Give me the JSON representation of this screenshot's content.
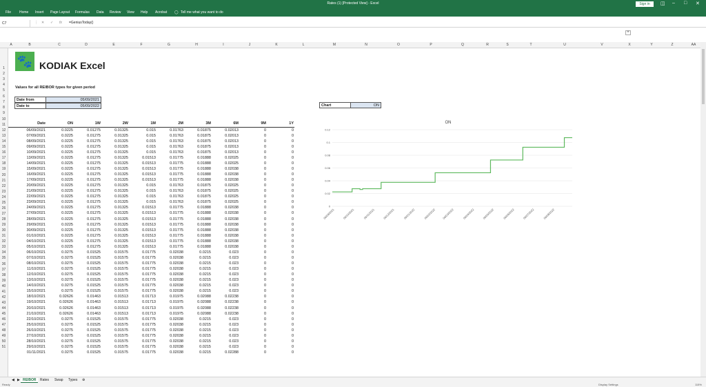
{
  "window": {
    "title": "Rates (1) [Protected View] - Excel",
    "signin": "Sign in"
  },
  "menu": [
    "File",
    "Home",
    "Insert",
    "Page Layout",
    "Formulas",
    "Data",
    "Review",
    "View",
    "Help",
    "Acrobat",
    "Tell me what you want to do"
  ],
  "formula_bar": {
    "name_box": "C7",
    "formula": "=GeniusToday()"
  },
  "columns": [
    "A",
    "B",
    "C",
    "D",
    "E",
    "F",
    "G",
    "H",
    "I",
    "J",
    "K",
    "L",
    "M",
    "N",
    "O",
    "P",
    "Q",
    "R",
    "S",
    "T",
    "U",
    "V",
    "X",
    "Y",
    "Z",
    "AA"
  ],
  "rows": [
    "1",
    "2",
    "3",
    "4",
    "5",
    "6",
    "7",
    "8",
    "9",
    "10",
    "11",
    "12",
    "13",
    "14",
    "15",
    "16",
    "17",
    "18",
    "19",
    "20",
    "21",
    "22",
    "23",
    "24",
    "25",
    "26",
    "27",
    "28",
    "29",
    "30",
    "31",
    "32",
    "33",
    "34",
    "35",
    "36",
    "37",
    "38",
    "39",
    "40",
    "41",
    "42",
    "43",
    "44",
    "45",
    "46",
    "47",
    "48",
    "49",
    "50",
    "51"
  ],
  "sheet": {
    "brand": "KODIAK Excel",
    "subtitle": "Values for all REIBOR types for given period",
    "date_from_label": "Date from",
    "date_from": "05/09/2021",
    "date_to_label": "Date to",
    "date_to": "05/09/2022",
    "chart_label": "Chart",
    "chart_value": "ON"
  },
  "table": {
    "headers": [
      "Date",
      "ON",
      "1W",
      "2W",
      "1M",
      "2M",
      "3M",
      "6M",
      "9M",
      "1Y"
    ],
    "rows": [
      [
        "06/09/2021",
        "0.0225",
        "0.01275",
        "0.01325",
        "0.015",
        "0.01763",
        "0.01875",
        "0.02013",
        "0",
        "0"
      ],
      [
        "07/09/2021",
        "0.0225",
        "0.01275",
        "0.01325",
        "0.015",
        "0.01763",
        "0.01875",
        "0.02013",
        "0",
        "0"
      ],
      [
        "08/09/2021",
        "0.0225",
        "0.01275",
        "0.01325",
        "0.015",
        "0.01763",
        "0.01875",
        "0.02013",
        "0",
        "0"
      ],
      [
        "09/09/2021",
        "0.0225",
        "0.01275",
        "0.01325",
        "0.015",
        "0.01763",
        "0.01875",
        "0.02013",
        "0",
        "0"
      ],
      [
        "10/09/2021",
        "0.0225",
        "0.01275",
        "0.01325",
        "0.015",
        "0.01763",
        "0.01875",
        "0.02013",
        "0",
        "0"
      ],
      [
        "13/09/2021",
        "0.0225",
        "0.01275",
        "0.01325",
        "0.01513",
        "0.01775",
        "0.01888",
        "0.02025",
        "0",
        "0"
      ],
      [
        "14/09/2021",
        "0.0225",
        "0.01275",
        "0.01325",
        "0.01513",
        "0.01775",
        "0.01888",
        "0.02025",
        "0",
        "0"
      ],
      [
        "15/09/2021",
        "0.0225",
        "0.01275",
        "0.01325",
        "0.01513",
        "0.01775",
        "0.01888",
        "0.02038",
        "0",
        "0"
      ],
      [
        "16/09/2021",
        "0.0225",
        "0.01275",
        "0.01325",
        "0.01513",
        "0.01775",
        "0.01888",
        "0.02038",
        "0",
        "0"
      ],
      [
        "17/09/2021",
        "0.0225",
        "0.01275",
        "0.01325",
        "0.01513",
        "0.01775",
        "0.01888",
        "0.02038",
        "0",
        "0"
      ],
      [
        "20/09/2021",
        "0.0225",
        "0.01275",
        "0.01325",
        "0.015",
        "0.01763",
        "0.01875",
        "0.02025",
        "0",
        "0"
      ],
      [
        "21/09/2021",
        "0.0225",
        "0.01275",
        "0.01325",
        "0.015",
        "0.01763",
        "0.01875",
        "0.02025",
        "0",
        "0"
      ],
      [
        "22/09/2021",
        "0.0225",
        "0.01275",
        "0.01325",
        "0.015",
        "0.01763",
        "0.01875",
        "0.02025",
        "0",
        "0"
      ],
      [
        "23/09/2021",
        "0.0225",
        "0.01275",
        "0.01325",
        "0.015",
        "0.01763",
        "0.01875",
        "0.02025",
        "0",
        "0"
      ],
      [
        "24/09/2021",
        "0.0225",
        "0.01275",
        "0.01325",
        "0.01513",
        "0.01775",
        "0.01888",
        "0.02038",
        "0",
        "0"
      ],
      [
        "27/09/2021",
        "0.0225",
        "0.01275",
        "0.01325",
        "0.01513",
        "0.01775",
        "0.01888",
        "0.02038",
        "0",
        "0"
      ],
      [
        "28/09/2021",
        "0.0225",
        "0.01275",
        "0.01325",
        "0.01513",
        "0.01775",
        "0.01888",
        "0.02038",
        "0",
        "0"
      ],
      [
        "29/09/2021",
        "0.0225",
        "0.01275",
        "0.01325",
        "0.01513",
        "0.01775",
        "0.01888",
        "0.02038",
        "0",
        "0"
      ],
      [
        "30/09/2021",
        "0.0225",
        "0.01275",
        "0.01325",
        "0.01513",
        "0.01775",
        "0.01888",
        "0.02038",
        "0",
        "0"
      ],
      [
        "01/10/2021",
        "0.0225",
        "0.01275",
        "0.01325",
        "0.01513",
        "0.01775",
        "0.01888",
        "0.02038",
        "0",
        "0"
      ],
      [
        "04/10/2021",
        "0.0225",
        "0.01275",
        "0.01325",
        "0.01513",
        "0.01775",
        "0.01888",
        "0.02038",
        "0",
        "0"
      ],
      [
        "05/10/2021",
        "0.0225",
        "0.01275",
        "0.01325",
        "0.01513",
        "0.01775",
        "0.01888",
        "0.02038",
        "0",
        "0"
      ],
      [
        "06/10/2021",
        "0.0275",
        "0.01525",
        "0.01575",
        "0.01775",
        "0.02038",
        "0.0215",
        "0.023",
        "0",
        "0"
      ],
      [
        "07/10/2021",
        "0.0275",
        "0.01525",
        "0.01575",
        "0.01775",
        "0.02038",
        "0.0215",
        "0.023",
        "0",
        "0"
      ],
      [
        "08/10/2021",
        "0.0275",
        "0.01525",
        "0.01575",
        "0.01775",
        "0.02038",
        "0.0215",
        "0.023",
        "0",
        "0"
      ],
      [
        "11/10/2021",
        "0.0275",
        "0.01525",
        "0.01575",
        "0.01775",
        "0.02038",
        "0.0215",
        "0.023",
        "0",
        "0"
      ],
      [
        "12/10/2021",
        "0.0275",
        "0.01525",
        "0.01575",
        "0.01775",
        "0.02038",
        "0.0215",
        "0.023",
        "0",
        "0"
      ],
      [
        "13/10/2021",
        "0.0275",
        "0.01525",
        "0.01575",
        "0.01775",
        "0.02038",
        "0.0215",
        "0.023",
        "0",
        "0"
      ],
      [
        "14/10/2021",
        "0.0275",
        "0.01525",
        "0.01575",
        "0.01775",
        "0.02038",
        "0.0215",
        "0.023",
        "0",
        "0"
      ],
      [
        "15/10/2021",
        "0.0275",
        "0.01525",
        "0.01575",
        "0.01775",
        "0.02038",
        "0.0215",
        "0.023",
        "0",
        "0"
      ],
      [
        "18/10/2021",
        "0.02626",
        "0.01463",
        "0.01513",
        "0.01713",
        "0.01975",
        "0.02088",
        "0.02238",
        "0",
        "0"
      ],
      [
        "19/10/2021",
        "0.02626",
        "0.01463",
        "0.01513",
        "0.01713",
        "0.01975",
        "0.02088",
        "0.02238",
        "0",
        "0"
      ],
      [
        "20/10/2021",
        "0.02626",
        "0.01463",
        "0.01513",
        "0.01713",
        "0.01975",
        "0.02088",
        "0.02238",
        "0",
        "0"
      ],
      [
        "21/10/2021",
        "0.02626",
        "0.01463",
        "0.01513",
        "0.01713",
        "0.01975",
        "0.02088",
        "0.02238",
        "0",
        "0"
      ],
      [
        "22/10/2021",
        "0.0275",
        "0.01525",
        "0.01575",
        "0.01775",
        "0.02038",
        "0.0215",
        "0.023",
        "0",
        "0"
      ],
      [
        "25/10/2021",
        "0.0275",
        "0.01525",
        "0.01575",
        "0.01775",
        "0.02038",
        "0.0215",
        "0.023",
        "0",
        "0"
      ],
      [
        "26/10/2021",
        "0.0275",
        "0.01525",
        "0.01575",
        "0.01775",
        "0.02038",
        "0.0215",
        "0.023",
        "0",
        "0"
      ],
      [
        "27/10/2021",
        "0.0275",
        "0.01525",
        "0.01575",
        "0.01775",
        "0.02038",
        "0.0215",
        "0.023",
        "0",
        "0"
      ],
      [
        "28/10/2021",
        "0.0275",
        "0.01525",
        "0.01575",
        "0.01775",
        "0.02038",
        "0.0215",
        "0.023",
        "0",
        "0"
      ],
      [
        "29/10/2021",
        "0.0275",
        "0.01525",
        "0.01575",
        "0.01775",
        "0.02038",
        "0.0215",
        "0.023",
        "0",
        "0"
      ],
      [
        "01/11/2021",
        "0.0275",
        "0.01525",
        "0.01575",
        "0.01775",
        "0.02038",
        "0.0215",
        "0.02288",
        "0",
        "0"
      ]
    ]
  },
  "chart_data": {
    "type": "line",
    "title": "ON",
    "color": "#5cb85c",
    "ylim": [
      0,
      0.12
    ],
    "yticks": [
      0,
      0.02,
      0.04,
      0.06,
      0.08,
      0.1,
      0.12
    ],
    "ytick_labels": [
      "0",
      "0.02",
      "0.04",
      "0.06",
      "0.08",
      "0.1",
      "0.12"
    ],
    "xlim": [
      "2021-09-06",
      "2022-09-05"
    ],
    "xtick_labels": [
      "06/09/2021",
      "06/10/2021",
      "06/11/2021",
      "06/12/2021",
      "06/01/2022",
      "06/02/2022",
      "06/03/2022",
      "06/04/2022",
      "06/05/2022",
      "06/06/2022",
      "06/07/2022",
      "06/08/2022"
    ],
    "x": [
      "2021-09-06",
      "2021-10-06",
      "2021-10-18",
      "2021-10-22",
      "2021-11-17",
      "2021-11-19",
      "2022-02-09",
      "2022-05-04",
      "2022-05-06",
      "2022-06-22",
      "2022-08-24",
      "2022-09-05"
    ],
    "values": [
      0.0225,
      0.0275,
      0.02626,
      0.0275,
      0.0275,
      0.0375,
      0.0525,
      0.0725,
      0.0725,
      0.0925,
      0.1075,
      0.1075
    ],
    "grid": true
  },
  "tabs": [
    "REIBOR",
    "Rates",
    "Swap",
    "Types"
  ],
  "status": {
    "ready": "Ready",
    "display": "Display Settings",
    "zoom": "115%"
  }
}
